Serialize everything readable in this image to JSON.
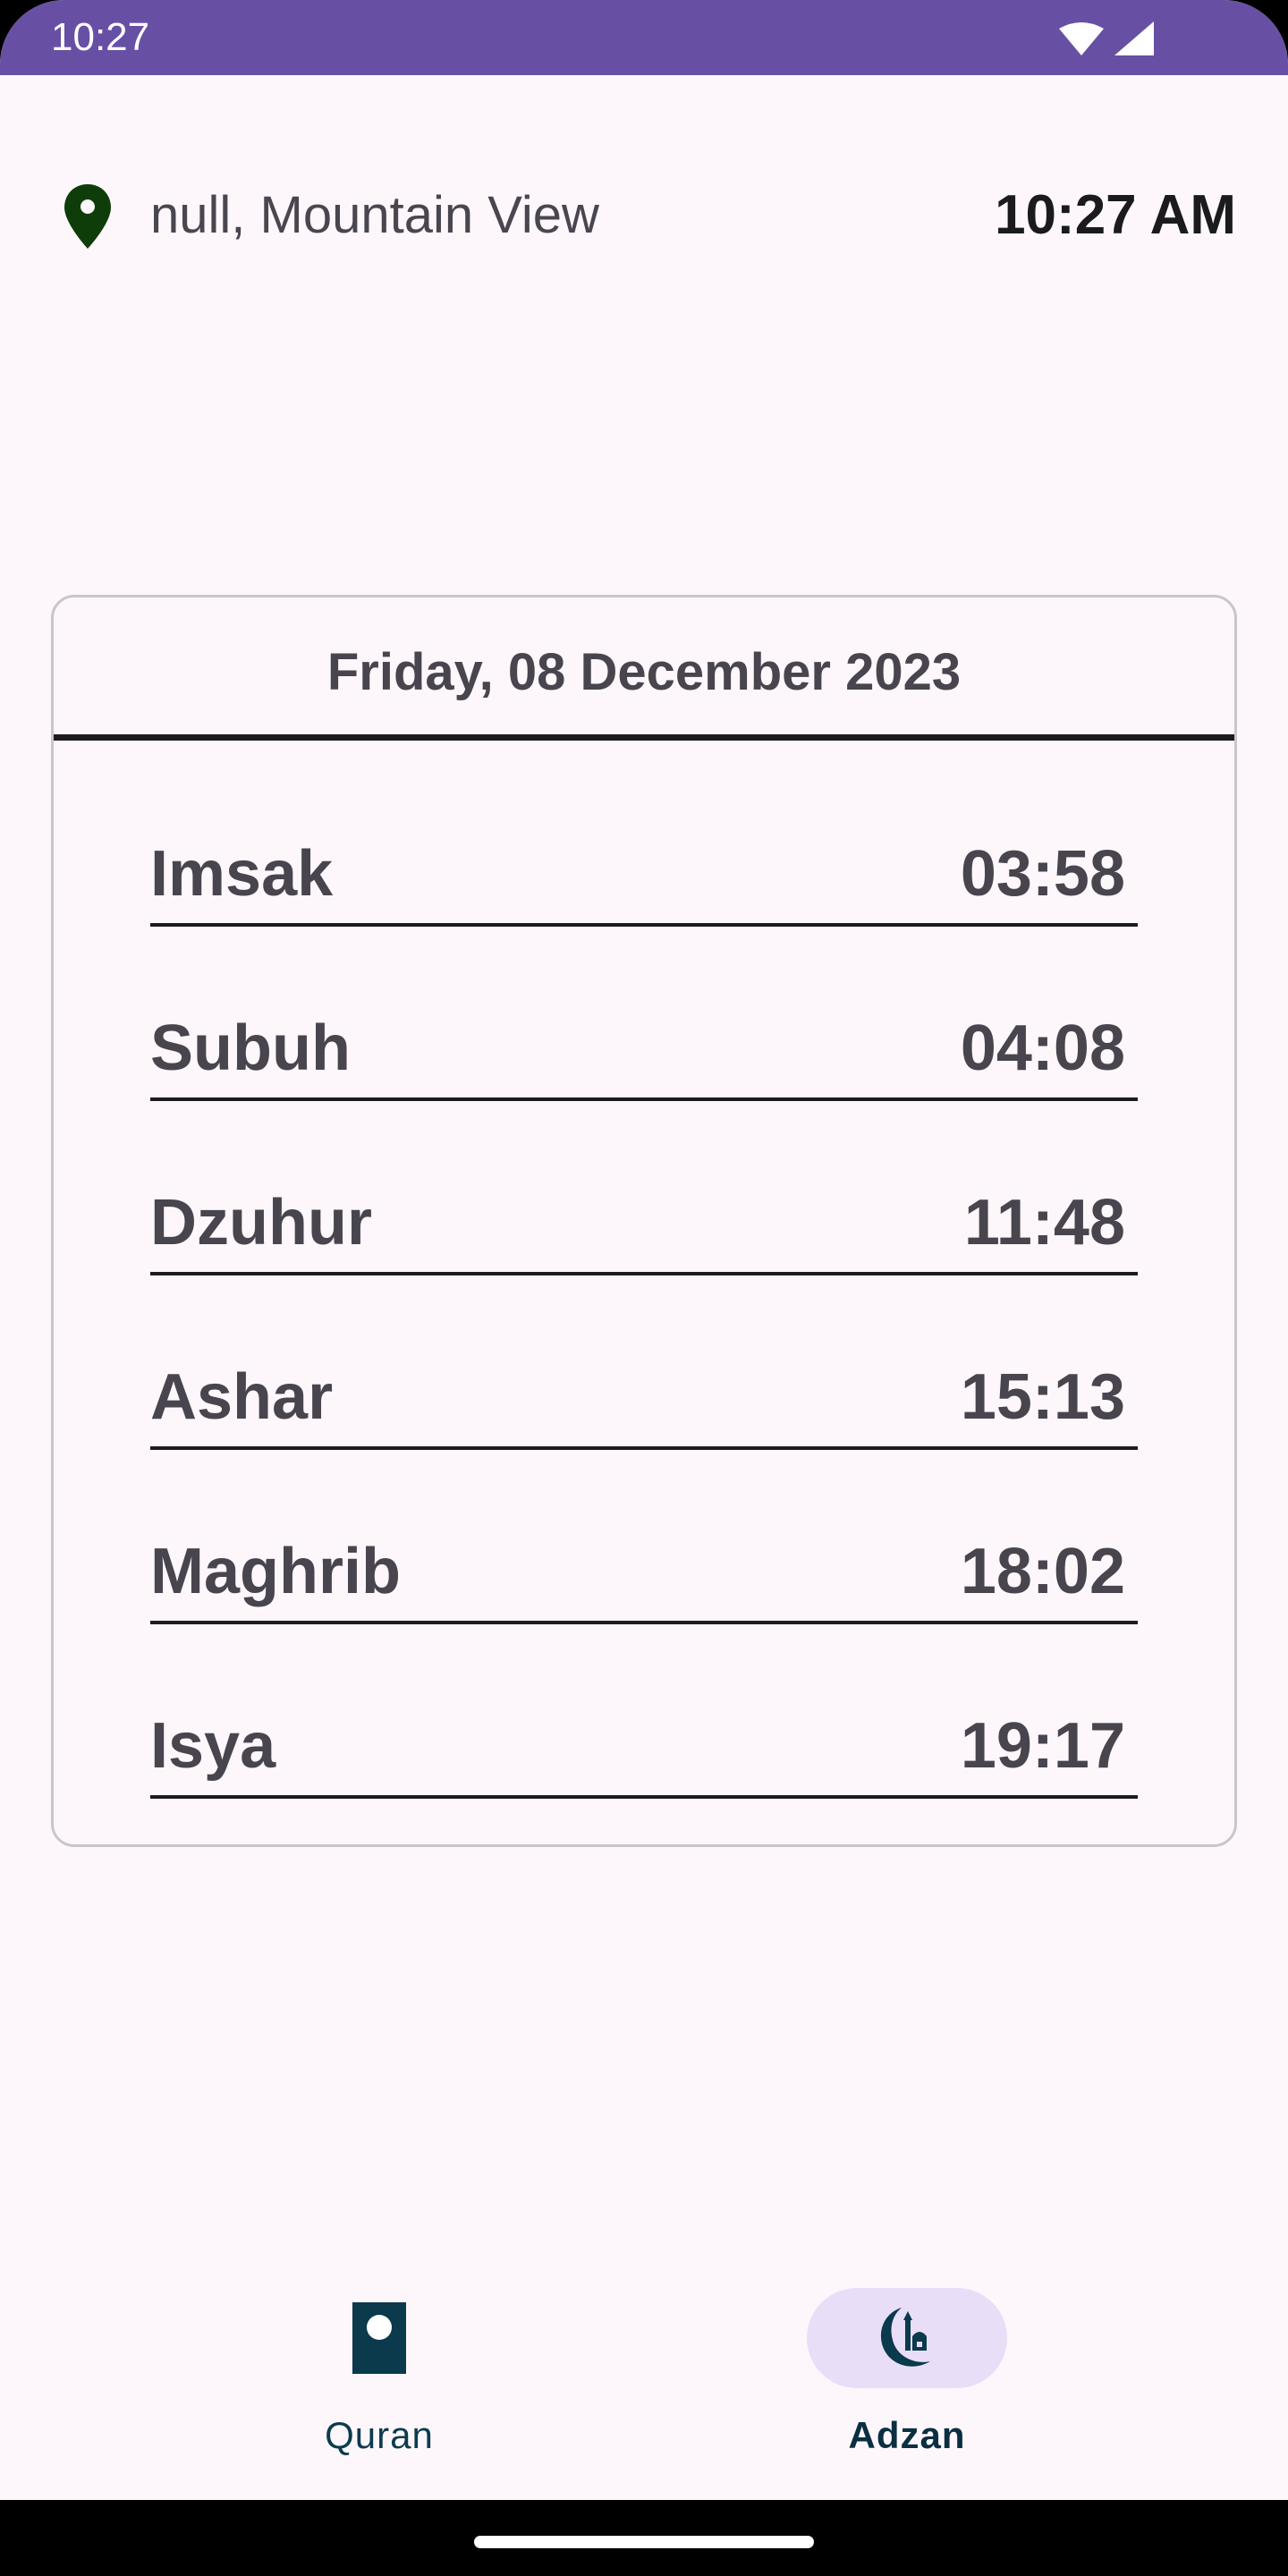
{
  "status_bar": {
    "time": "10:27",
    "background_color": "#6750a4",
    "icons": [
      "wifi-icon",
      "cellular-signal-icon"
    ]
  },
  "header": {
    "location": "null, Mountain View",
    "current_time": "10:27 AM",
    "location_icon": "location-pin-icon",
    "location_icon_color": "#0f3d0a"
  },
  "schedule": {
    "date": "Friday, 08 December 2023",
    "prayers": [
      {
        "name": "Imsak",
        "time": "03:58"
      },
      {
        "name": "Subuh",
        "time": "04:08"
      },
      {
        "name": "Dzuhur",
        "time": "11:48"
      },
      {
        "name": "Ashar",
        "time": "15:13"
      },
      {
        "name": "Maghrib",
        "time": "18:02"
      },
      {
        "name": "Isya",
        "time": "19:17"
      }
    ]
  },
  "bottom_nav": {
    "items": [
      {
        "label": "Quran",
        "icon": "book-icon",
        "selected": false
      },
      {
        "label": "Adzan",
        "icon": "mosque-crescent-icon",
        "selected": true
      }
    ],
    "selected_indicator_color": "#e8def8",
    "icon_color": "#0a3a4c"
  }
}
